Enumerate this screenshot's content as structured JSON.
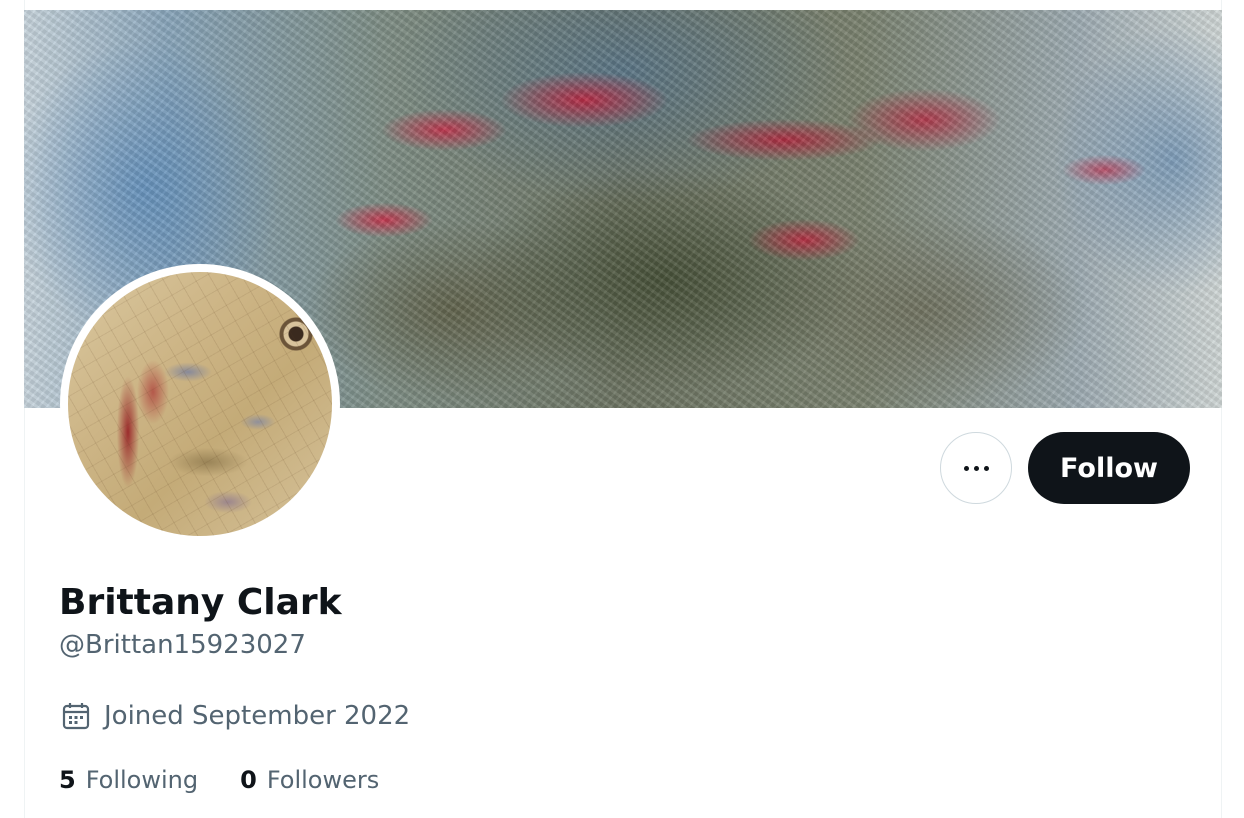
{
  "profile": {
    "display_name": "Brittany Clark",
    "handle": "@Brittan15923027",
    "joined": "Joined September 2022",
    "follow_label": "Follow",
    "more_icon": "more-horizontal-icon",
    "calendar_icon": "calendar-icon"
  },
  "stats": {
    "following_count": "5",
    "following_label": "Following",
    "followers_count": "0",
    "followers_label": "Followers"
  },
  "colors": {
    "primary_text": "#0f1419",
    "secondary_text": "#536471",
    "follow_button_bg": "#0f1419",
    "border": "#cfd9de"
  }
}
